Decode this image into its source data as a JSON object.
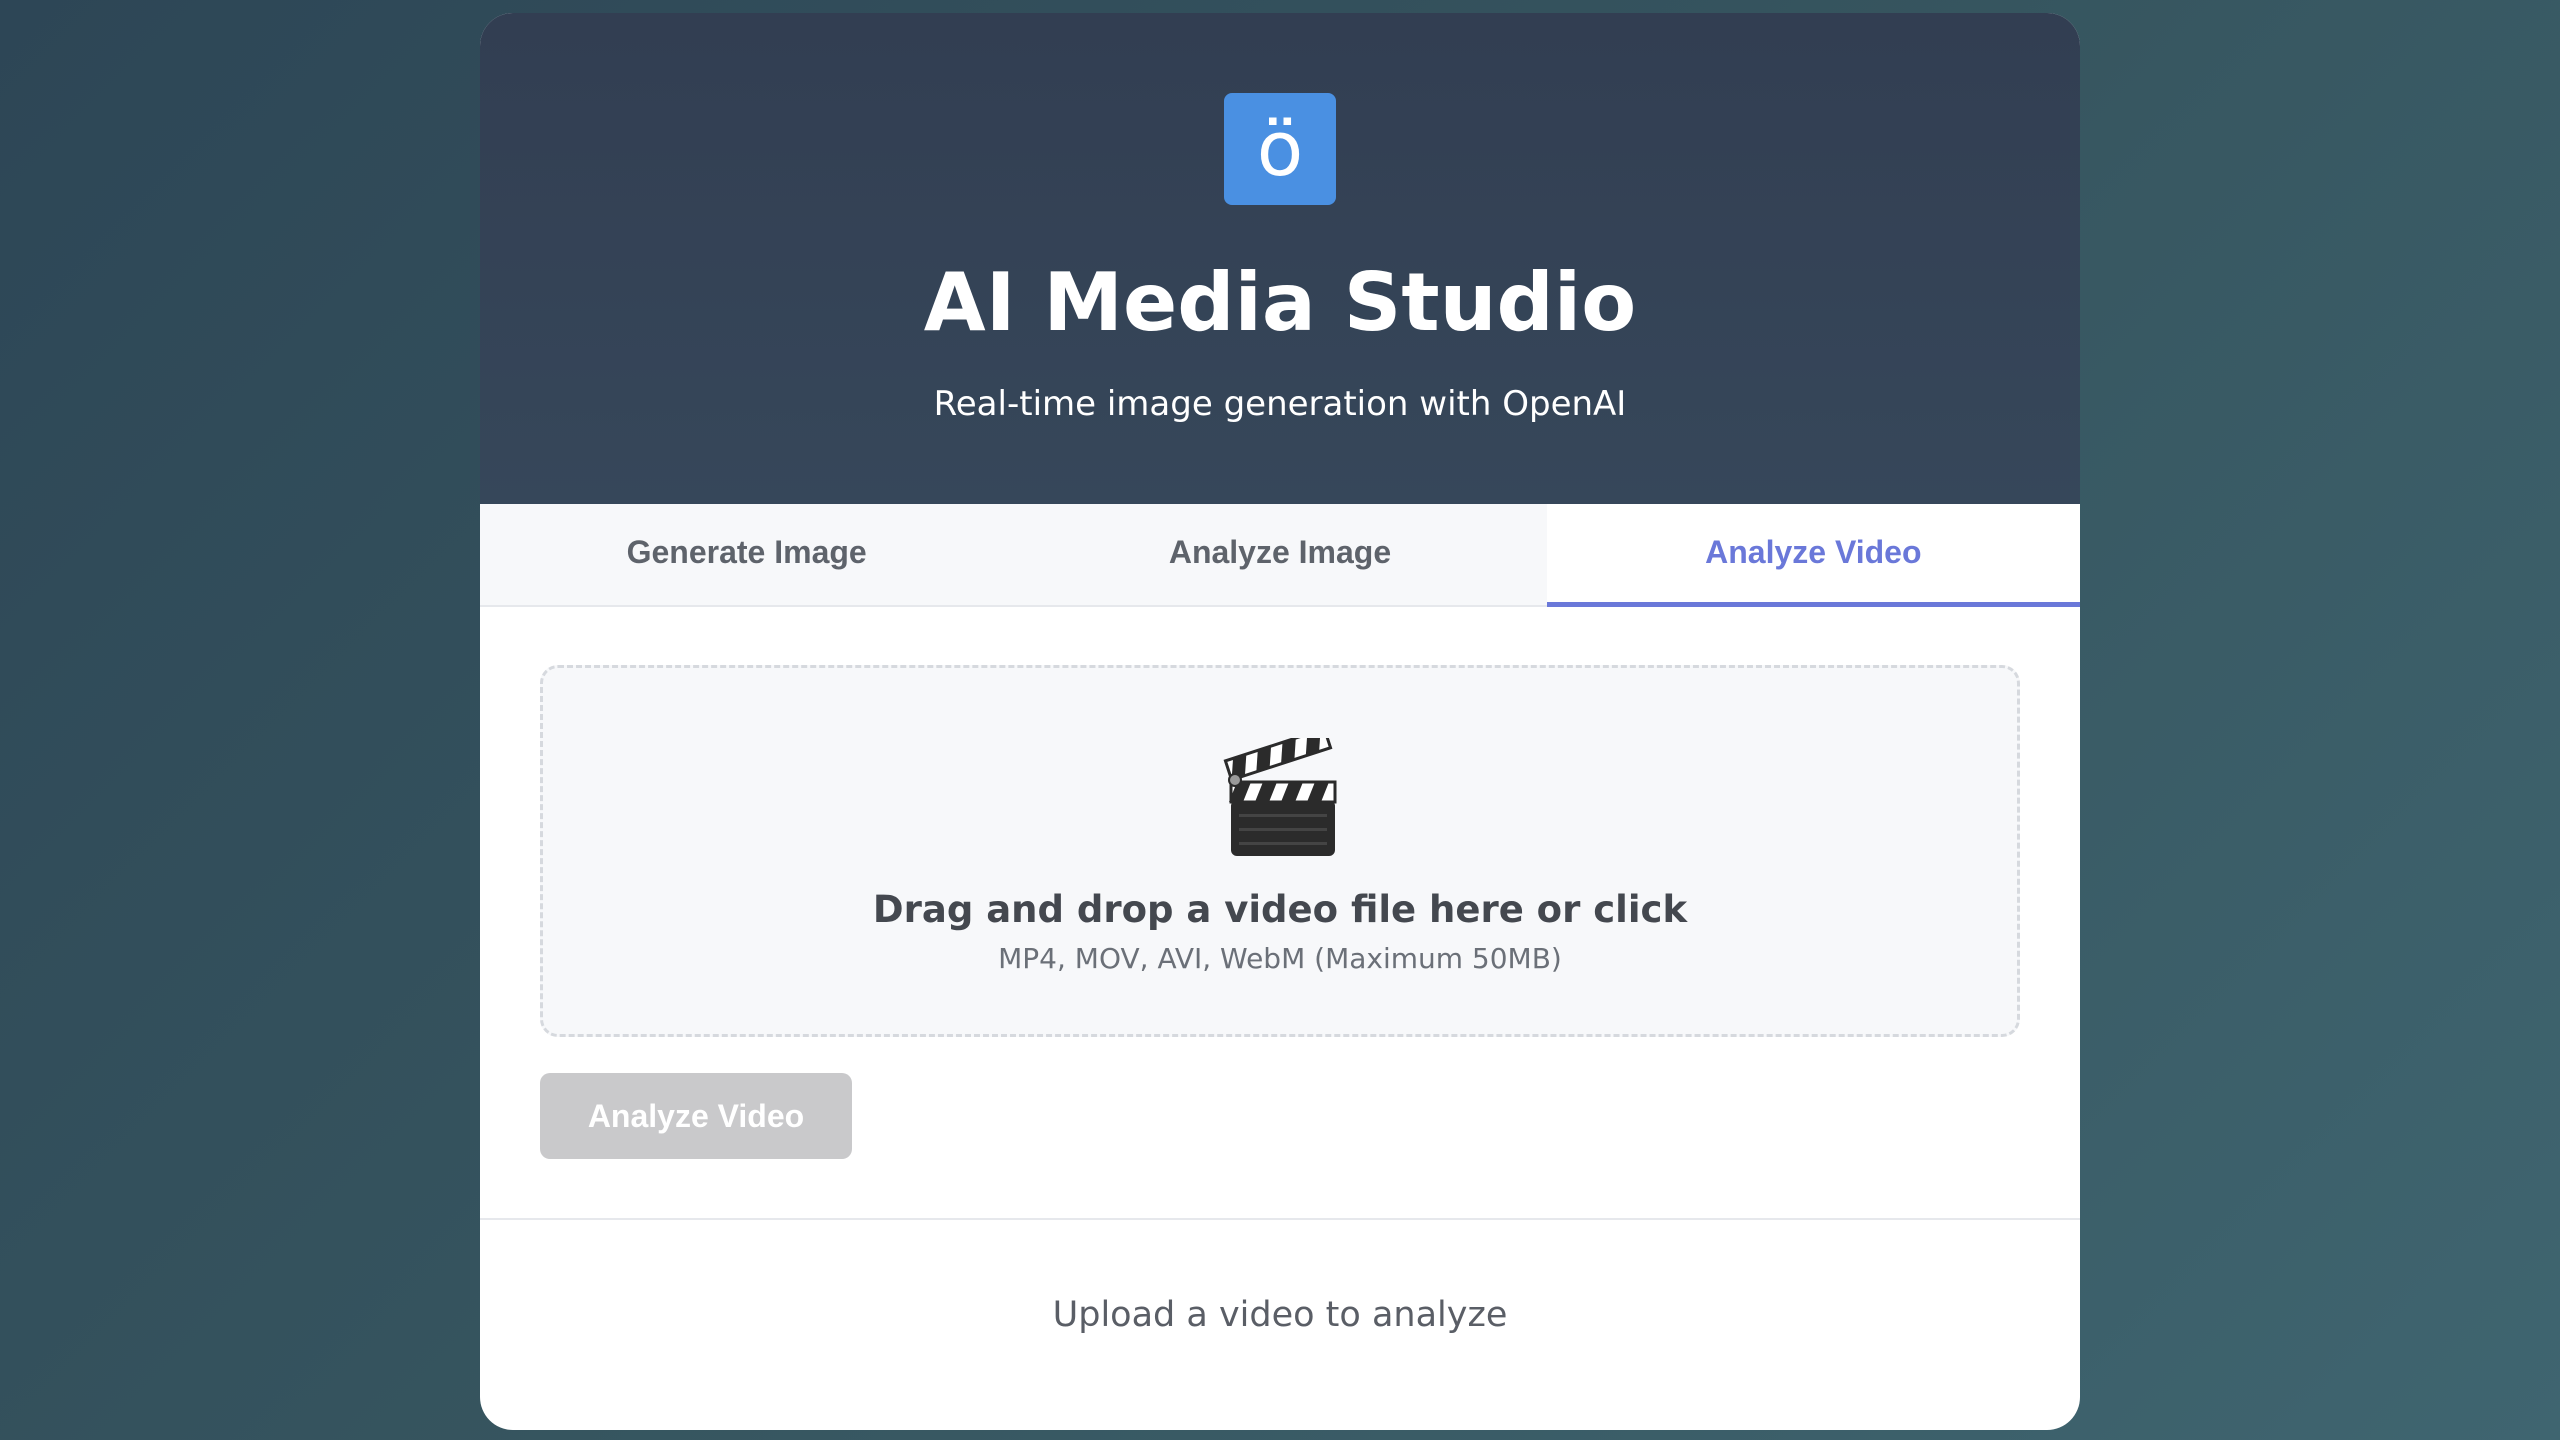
{
  "header": {
    "logo_glyph": "ö",
    "title": "AI Media Studio",
    "subtitle": "Real-time image generation with OpenAI"
  },
  "tabs": [
    {
      "label": "Generate Image",
      "active": false
    },
    {
      "label": "Analyze Image",
      "active": false
    },
    {
      "label": "Analyze Video",
      "active": true
    }
  ],
  "upload": {
    "icon": "clapperboard-icon",
    "title": "Drag and drop a video file here or click",
    "hint": "MP4, MOV, AVI, WebM (Maximum 50MB)"
  },
  "action": {
    "button_label": "Analyze Video",
    "disabled": true
  },
  "result": {
    "placeholder": "Upload a video to analyze"
  },
  "colors": {
    "accent": "#6a78d9",
    "logo_bg": "#4a90e2",
    "header_bg": "#323e52",
    "button_disabled": "#c9c9cb"
  }
}
